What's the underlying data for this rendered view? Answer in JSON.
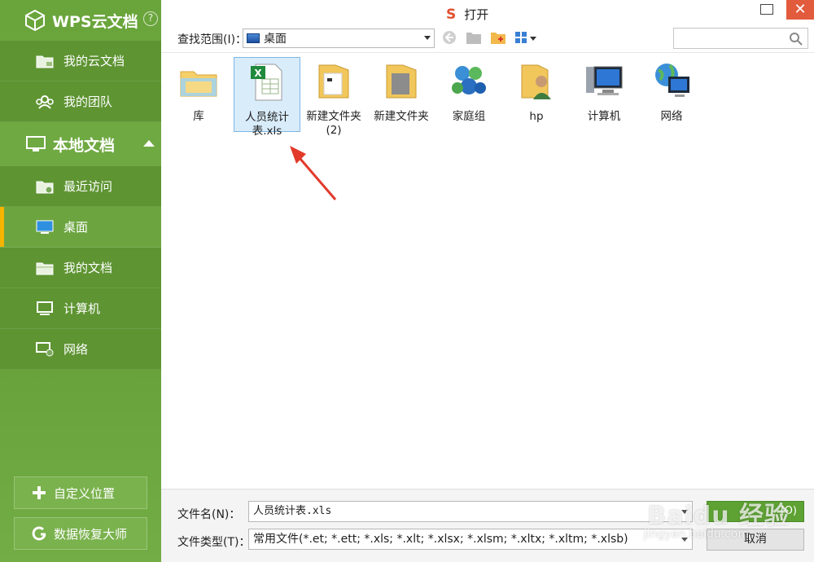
{
  "sidebar": {
    "brand": "WPS云文档",
    "help": "?",
    "cloud_items": [
      {
        "label": "我的云文档",
        "icon": "cloud-folder-icon"
      },
      {
        "label": "我的团队",
        "icon": "team-icon"
      }
    ],
    "local_section": "本地文档",
    "local_items": [
      {
        "label": "最近访问",
        "icon": "recent-folder-icon"
      },
      {
        "label": "桌面",
        "icon": "desktop-icon"
      },
      {
        "label": "我的文档",
        "icon": "documents-folder-icon"
      },
      {
        "label": "计算机",
        "icon": "computer-icon"
      },
      {
        "label": "网络",
        "icon": "network-icon"
      }
    ],
    "custom_location": "自定义位置",
    "data_recovery": "数据恢复大师"
  },
  "dialog": {
    "title": "打开",
    "logo": "S",
    "close": "✕"
  },
  "toolbar": {
    "look_in_label": "查找范围(I)：",
    "look_in_value": "桌面",
    "search_placeholder": ""
  },
  "files": [
    {
      "name": "库",
      "icon": "library-icon"
    },
    {
      "name": "人员统计表.xls",
      "icon": "excel-file-icon"
    },
    {
      "name": "新建文件夹 (2)",
      "icon": "folder-icon"
    },
    {
      "name": "新建文件夹",
      "icon": "folder-icon"
    },
    {
      "name": "家庭组",
      "icon": "homegroup-icon"
    },
    {
      "name": "hp",
      "icon": "user-folder-icon"
    },
    {
      "name": "计算机",
      "icon": "computer-icon"
    },
    {
      "name": "网络",
      "icon": "network-icon"
    }
  ],
  "bottom": {
    "filename_label": "文件名(N)：",
    "filename_value": "人员统计表.xls",
    "filetype_label": "文件类型(T)：",
    "filetype_value": "常用文件(*.et; *.ett; *.xls; *.xlt; *.xlsx; *.xlsm; *.xltx; *.xltm; *.xlsb)",
    "open_button": "(O)",
    "cancel_button": "取消"
  },
  "watermark": {
    "main": "Baidu 经验",
    "sub": "jingyan.baidu.com"
  },
  "colors": {
    "sidebar_green": "#5f9a33",
    "active_marker": "#f4b400",
    "selection": "#d9ecfa",
    "close_red": "#e25b3c"
  }
}
